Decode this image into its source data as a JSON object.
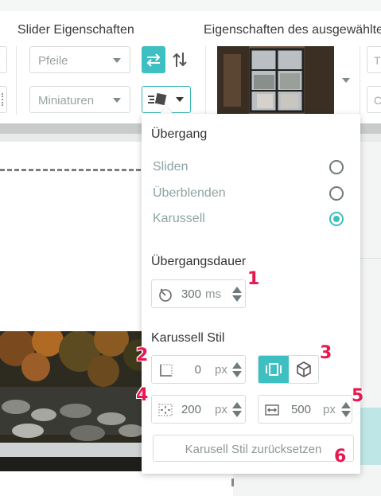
{
  "toolbar": {
    "slider_props_title": "Slider Eigenschaften",
    "selected_props_title": "Eigenschaften des ausgewählten",
    "arrows_select": "Pfeile",
    "thumbs_select": "Miniaturen",
    "partial_input_1": "T",
    "partial_input_2": "C",
    "active_color": "#3ebfc2"
  },
  "panel": {
    "transition_title": "Übergang",
    "options": [
      {
        "label": "Sliden",
        "checked": false
      },
      {
        "label": "Überblenden",
        "checked": false
      },
      {
        "label": "Karussell",
        "checked": true
      }
    ],
    "duration_title": "Übergangsdauer",
    "duration": {
      "value": "300",
      "unit": "ms"
    },
    "carousel_title": "Karussell Stil",
    "spacing": {
      "value": "0",
      "unit": "px"
    },
    "padding": {
      "value": "200",
      "unit": "px"
    },
    "width": {
      "value": "500",
      "unit": "px"
    },
    "reset_label": "Karusell Stil zurücksetzen"
  },
  "annotations": [
    "1",
    "2",
    "3",
    "4",
    "5",
    "6"
  ],
  "icons": {
    "swap_horizontal": "swap-horizontal-icon",
    "swap_vertical": "swap-vertical-icon",
    "transition": "transition-effect-icon",
    "timer": "timer-icon",
    "spacing": "spacing-icon",
    "padding": "padding-icon",
    "width": "width-icon",
    "carousel_flat": "carousel-flat-icon",
    "carousel_3d": "cube-icon"
  }
}
